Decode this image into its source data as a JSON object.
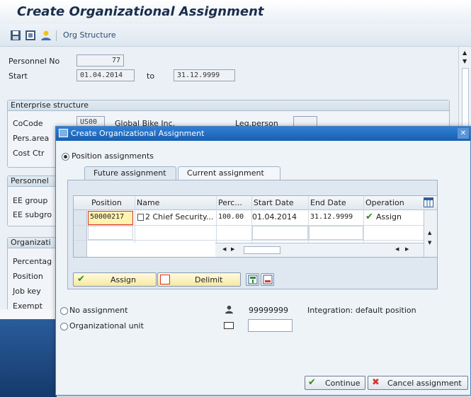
{
  "title": "Create Organizational Assignment",
  "toolbar": {
    "org_structure": "Org Structure"
  },
  "header": {
    "personnel_no_label": "Personnel No",
    "personnel_no": "77",
    "start_label": "Start",
    "start_date": "01.04.2014",
    "to_label": "to",
    "end_date": "31.12.9999"
  },
  "enterprise": {
    "title": "Enterprise structure",
    "cocode_label": "CoCode",
    "cocode": "US00",
    "cocode_text": "Global Bike Inc.",
    "leg_person_label": "Leg.person",
    "pers_area_label": "Pers.area",
    "cost_ctr_label": "Cost Ctr"
  },
  "personnel": {
    "title": "Personnel",
    "ee_group_label": "EE group",
    "ee_subgroup_label": "EE subgro"
  },
  "organizational": {
    "title": "Organizati",
    "percentage_label": "Percentag",
    "position_label": "Position",
    "job_key_label": "Job key",
    "exempt_label": "Exempt"
  },
  "dialog": {
    "title": "Create Organizational Assignment",
    "close": "✕",
    "position_assignments": "Position assignments",
    "tabs": [
      "Future assignment",
      "Current assignment"
    ],
    "columns": [
      "Position",
      "Name",
      "Perc...",
      "Start Date",
      "End Date",
      "Operation"
    ],
    "row": {
      "position": "50000217",
      "name": "2 Chief Security...",
      "percentage": "100.00",
      "start_date": "01.04.2014",
      "end_date": "31.12.9999",
      "operation": "Assign"
    },
    "assign_button": "Assign",
    "delimit_button": "Delimit",
    "no_assignment": "No assignment",
    "default_position": "99999999",
    "integration_text": "Integration: default position",
    "org_unit": "Organizational unit",
    "continue_button": "Continue",
    "cancel_button": "Cancel assignment"
  },
  "colors": {
    "title_bar": "#1f6fc4",
    "accent_red": "#d9342b",
    "check_green": "#2e8b1f",
    "highlight": "#fff3b0"
  }
}
